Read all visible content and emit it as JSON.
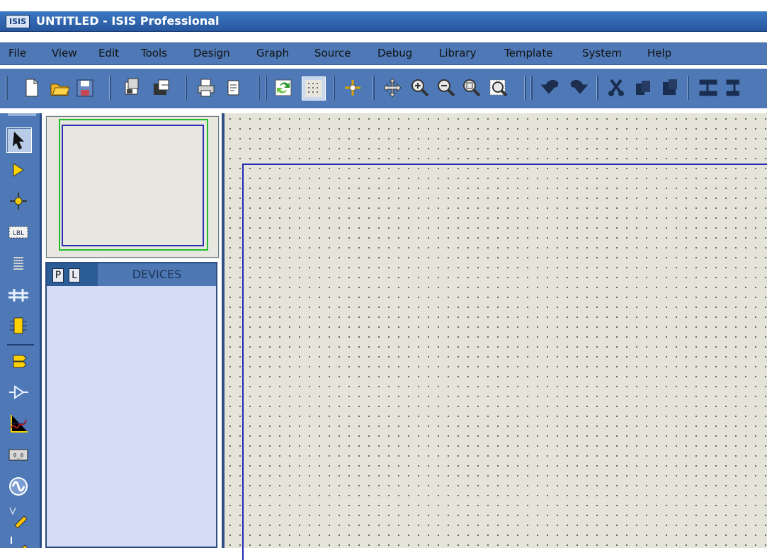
{
  "window": {
    "title": "UNTITLED - ISIS Professional",
    "logo_text": "ISIS"
  },
  "menu": {
    "items": [
      "File",
      "View",
      "Edit",
      "Tools",
      "Design",
      "Graph",
      "Source",
      "Debug",
      "Library",
      "Template",
      "System",
      "Help"
    ]
  },
  "toolbar": {
    "icons": [
      "new-file-icon",
      "open-folder-icon",
      "save-icon",
      "import-section-icon",
      "export-section-icon",
      "print-icon",
      "print-preview-icon",
      "refresh-icon",
      "grid-toggle-icon",
      "origin-icon",
      "pan-icon",
      "zoom-in-icon",
      "zoom-out-icon",
      "zoom-all-icon",
      "zoom-area-icon",
      "undo-icon",
      "redo-icon",
      "cut-icon",
      "copy-icon",
      "paste-icon",
      "align-icon"
    ]
  },
  "left_tools": {
    "icons": [
      "selection-arrow-icon",
      "component-mode-icon",
      "junction-dot-icon",
      "wire-label-icon",
      "text-script-icon",
      "bus-icon",
      "subcircuit-icon",
      "terminal-icon",
      "device-pin-icon",
      "graph-icon",
      "tape-recorder-icon",
      "generator-icon",
      "voltage-probe-icon",
      "current-probe-icon"
    ]
  },
  "devices": {
    "p_button": "P",
    "l_button": "L",
    "title": "DEVICES"
  },
  "colors": {
    "chrome_blue": "#4e79b6",
    "title_blue": "#3c79c4",
    "canvas": "#e5e4d8",
    "sheet_border": "#2328b7",
    "preview_green": "#23bd2b",
    "devices_bg": "#d5dcf5"
  }
}
